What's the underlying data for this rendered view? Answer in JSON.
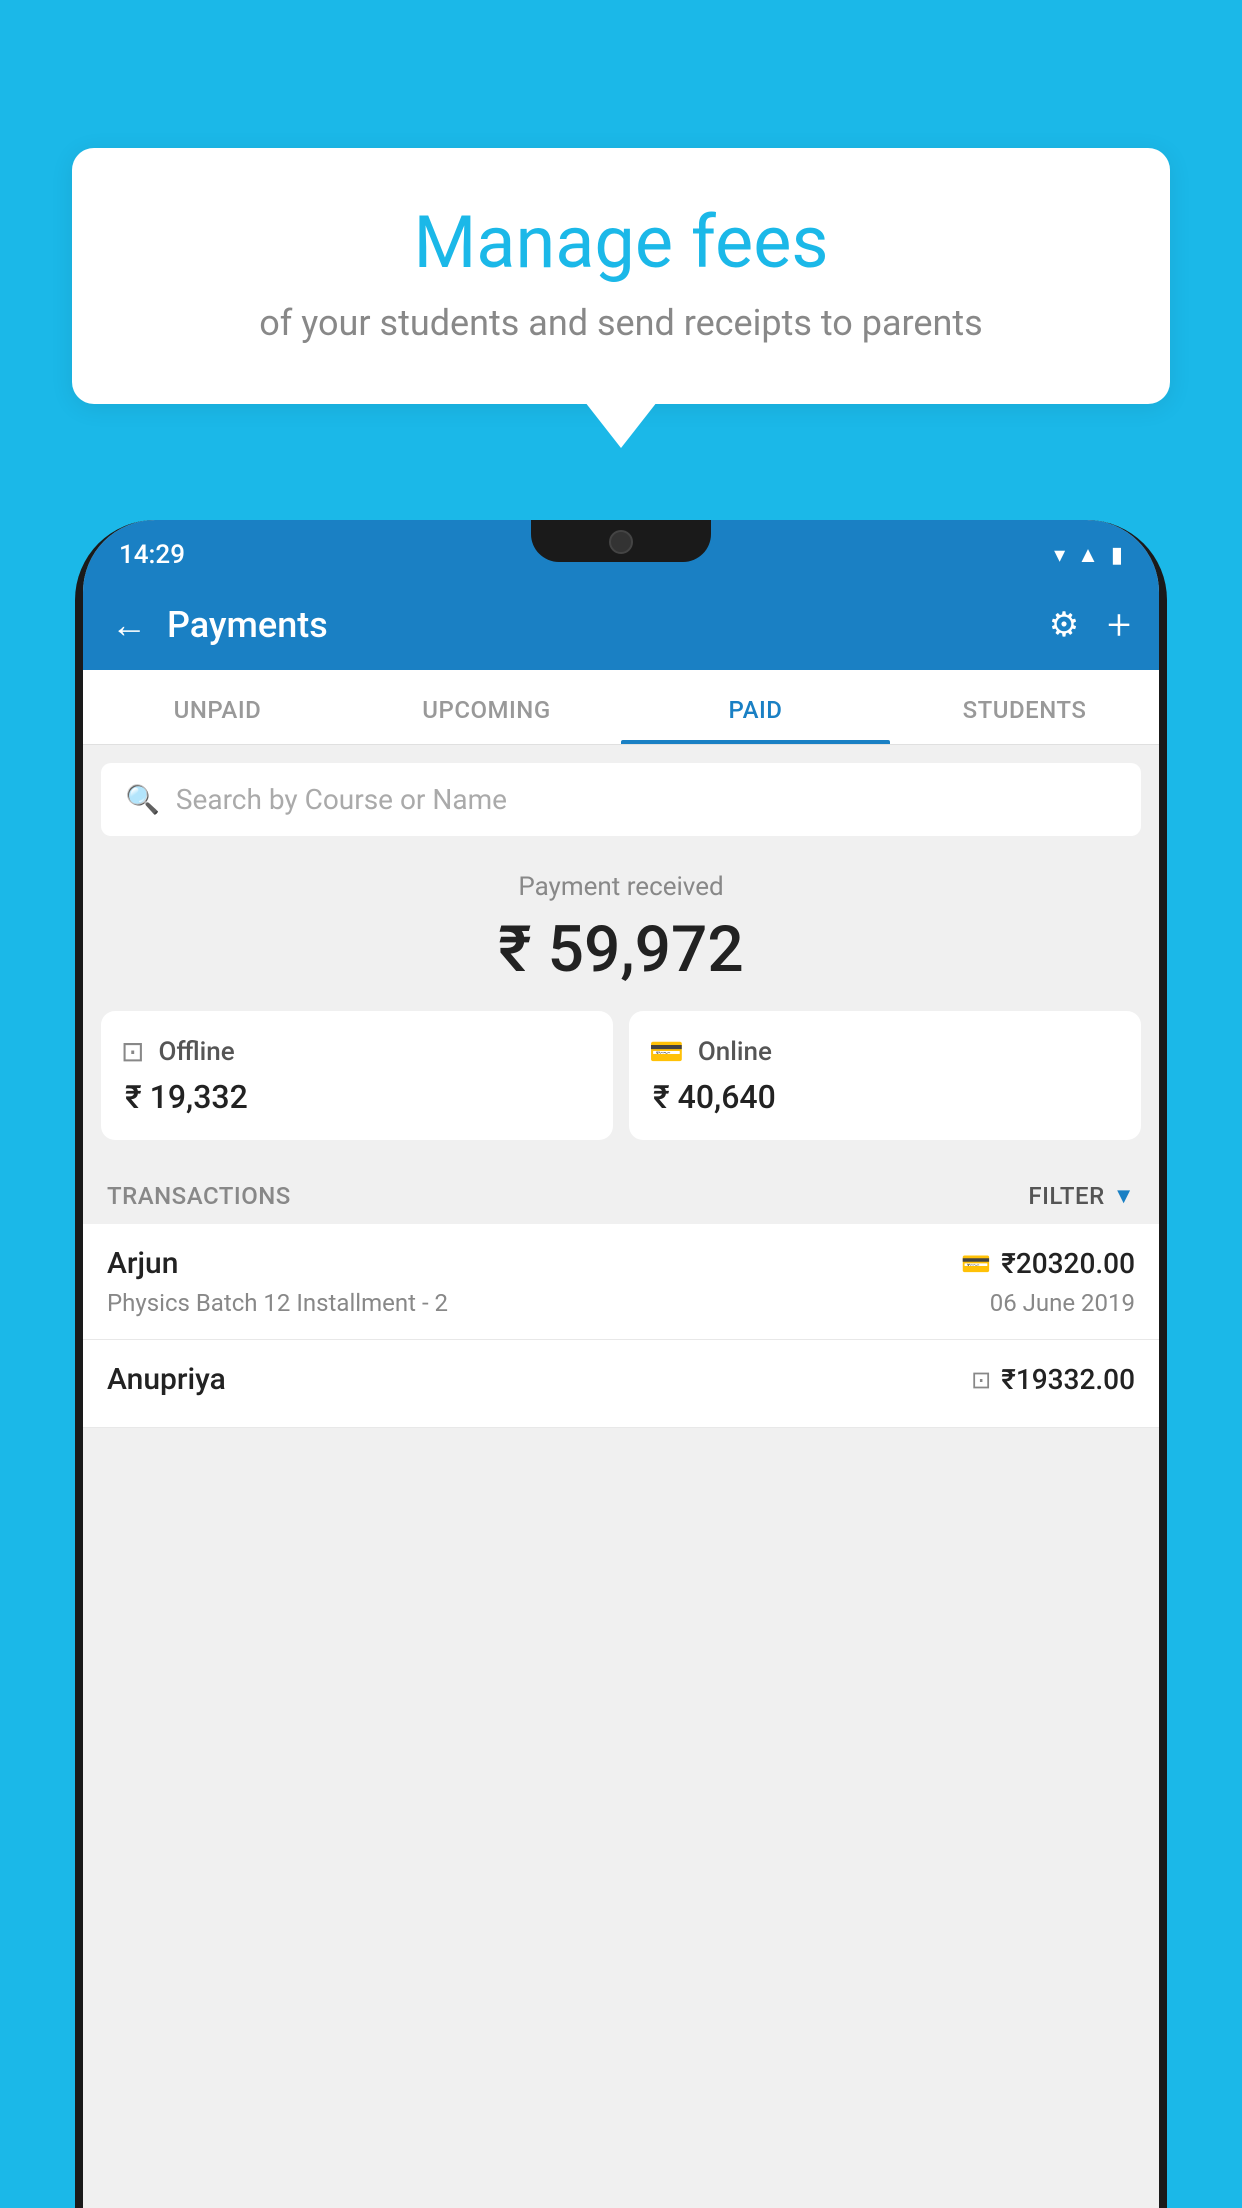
{
  "background_color": "#1bb8e8",
  "tooltip": {
    "title": "Manage fees",
    "subtitle": "of your students and send receipts to parents"
  },
  "status_bar": {
    "time": "14:29",
    "icons": [
      "wifi",
      "signal",
      "battery"
    ]
  },
  "header": {
    "title": "Payments",
    "back_label": "←",
    "settings_icon": "gear",
    "add_icon": "+"
  },
  "tabs": [
    {
      "label": "UNPAID",
      "active": false
    },
    {
      "label": "UPCOMING",
      "active": false
    },
    {
      "label": "PAID",
      "active": true
    },
    {
      "label": "STUDENTS",
      "active": false
    }
  ],
  "search": {
    "placeholder": "Search by Course or Name"
  },
  "payment_summary": {
    "label": "Payment received",
    "amount": "₹ 59,972",
    "offline": {
      "icon": "offline-payment",
      "type": "Offline",
      "amount": "₹ 19,332"
    },
    "online": {
      "icon": "card-payment",
      "type": "Online",
      "amount": "₹ 40,640"
    }
  },
  "transactions": {
    "header_label": "TRANSACTIONS",
    "filter_label": "FILTER",
    "rows": [
      {
        "name": "Arjun",
        "amount": "₹20320.00",
        "payment_type": "card",
        "course": "Physics Batch 12 Installment - 2",
        "date": "06 June 2019"
      },
      {
        "name": "Anupriya",
        "amount": "₹19332.00",
        "payment_type": "offline",
        "course": "",
        "date": ""
      }
    ]
  }
}
